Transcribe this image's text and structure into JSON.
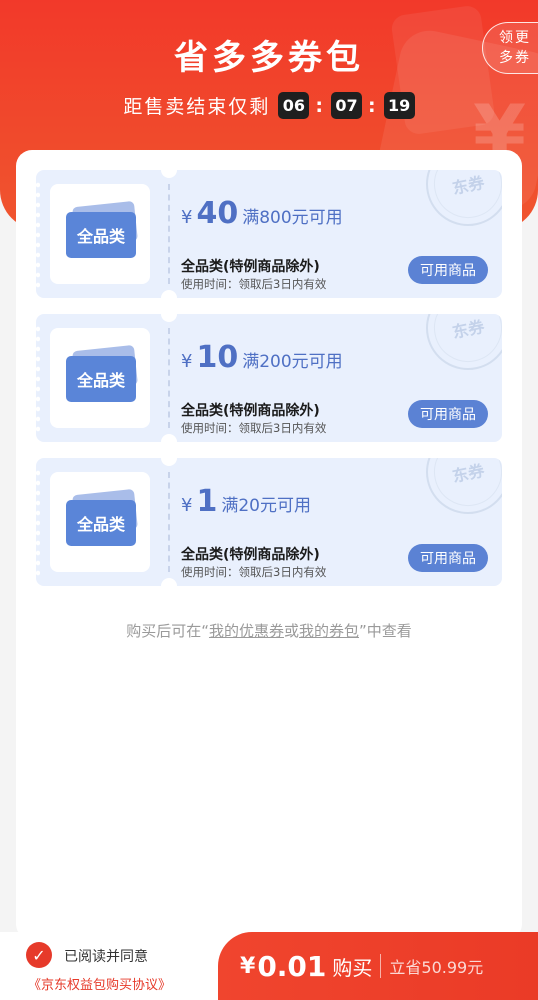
{
  "header": {
    "title": "省多多券包",
    "more_button": [
      "领更",
      "多券"
    ],
    "countdown_label": "距售卖结束仅剩",
    "countdown": [
      "06",
      "07",
      "19"
    ]
  },
  "coupons": [
    {
      "yen": "¥",
      "amount": "40",
      "condition": "满800元可用",
      "name": "全品类(特例商品除外)",
      "validity": "使用时间：领取后3日内有效",
      "button": "可用商品",
      "ticket_label": "全品类",
      "stamp": "东券"
    },
    {
      "yen": "¥",
      "amount": "10",
      "condition": "满200元可用",
      "name": "全品类(特例商品除外)",
      "validity": "使用时间：领取后3日内有效",
      "button": "可用商品",
      "ticket_label": "全品类",
      "stamp": "东券"
    },
    {
      "yen": "¥",
      "amount": "1",
      "condition": "满20元可用",
      "name": "全品类(特例商品除外)",
      "validity": "使用时间：领取后3日内有效",
      "button": "可用商品",
      "ticket_label": "全品类",
      "stamp": "东券"
    }
  ],
  "note": {
    "prefix": "购买后可在“",
    "link1": "我的优惠券",
    "mid": "或",
    "link2": "我的券包",
    "suffix": "”中查看"
  },
  "footer": {
    "agree_text": "已阅读并同意",
    "agreement_link": "《京东权益包购买协议》",
    "yen": "¥",
    "price": "0.01",
    "buy_label": "购买",
    "save_text": "立省50.99元"
  },
  "colors": {
    "brand_red": "#f0452e",
    "coupon_blue": "#5b82d4"
  }
}
